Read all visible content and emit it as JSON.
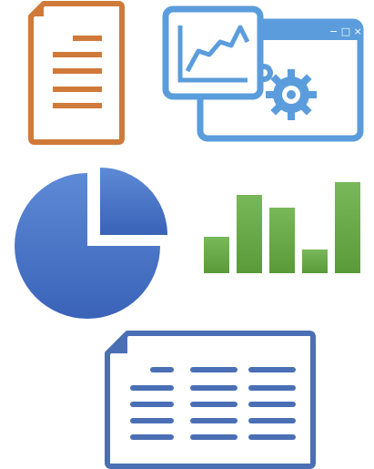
{
  "colors": {
    "document": "#cf7a3a",
    "dashboard": "#5b9ddc",
    "dashboard_dark": "#4a88c8",
    "pie": "#3f6fc4",
    "pie_light": "#5d8ad6",
    "bars": "#6fb04a",
    "bars_dark": "#5c9e3c",
    "spreadsheet": "#4a6fb5"
  },
  "icons": [
    {
      "name": "document-icon"
    },
    {
      "name": "analytics-dashboard-icon"
    },
    {
      "name": "pie-chart-icon"
    },
    {
      "name": "bar-chart-icon"
    },
    {
      "name": "spreadsheet-icon"
    }
  ],
  "bar_chart_levels": [
    0.4,
    0.86,
    0.72,
    0.26,
    1.0
  ]
}
